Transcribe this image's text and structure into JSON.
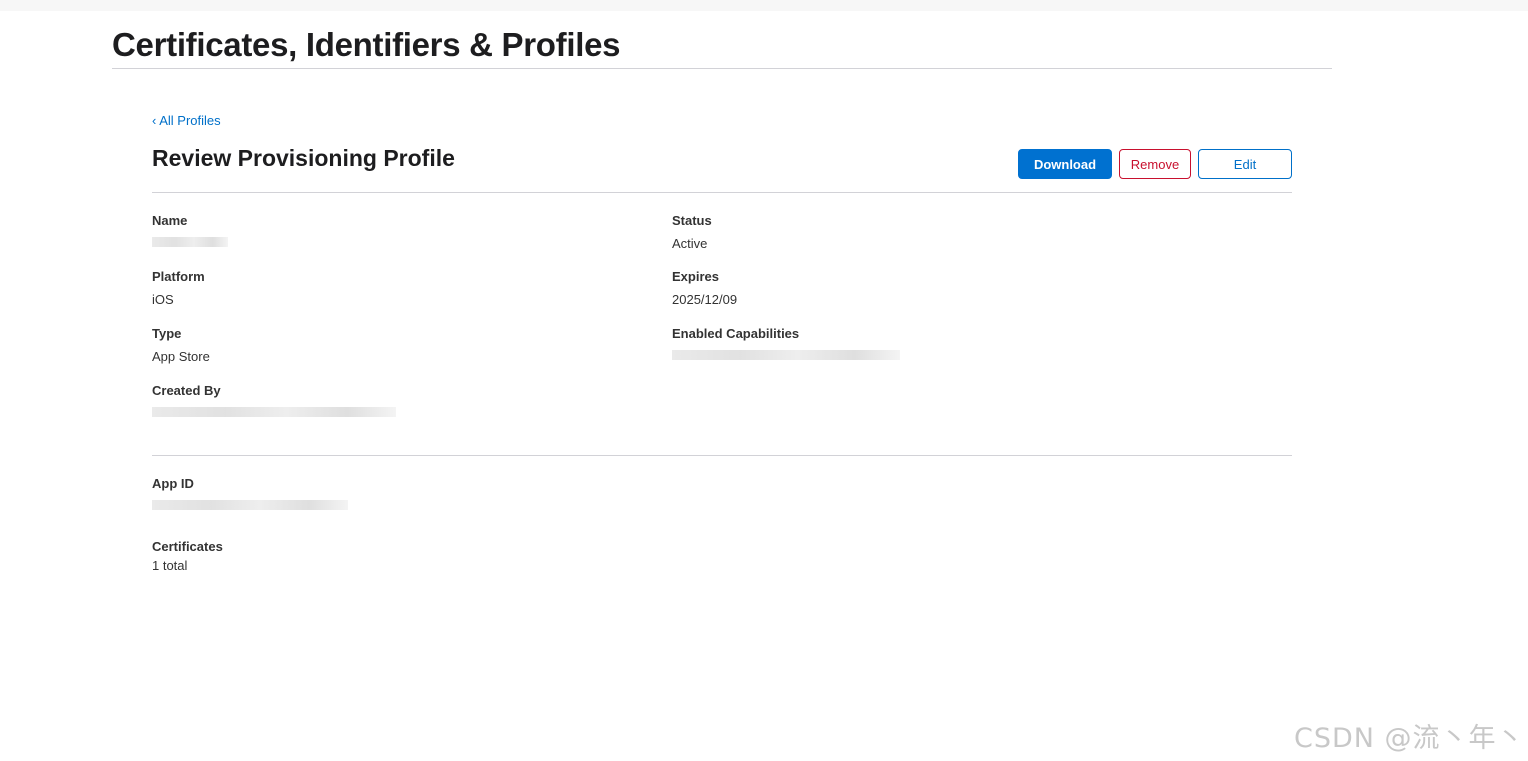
{
  "header": {
    "title": "Certificates, Identifiers & Profiles"
  },
  "nav": {
    "back_link": "‹ All Profiles"
  },
  "profile": {
    "section_title": "Review Provisioning Profile",
    "actions": {
      "download": "Download",
      "remove": "Remove",
      "edit": "Edit"
    },
    "fields": {
      "name": {
        "label": "Name"
      },
      "status": {
        "label": "Status",
        "value": "Active"
      },
      "platform": {
        "label": "Platform",
        "value": "iOS"
      },
      "expires": {
        "label": "Expires",
        "value": "2025/12/09"
      },
      "type": {
        "label": "Type",
        "value": "App Store"
      },
      "enabled_capabilities": {
        "label": "Enabled Capabilities"
      },
      "created_by": {
        "label": "Created By"
      },
      "app_id": {
        "label": "App ID"
      },
      "certificates": {
        "label": "Certificates",
        "value": "1 total"
      }
    }
  },
  "watermark": {
    "text": "CSDN @流丶年丶"
  },
  "colors": {
    "accent": "#0071d0",
    "danger": "#c8102e",
    "text": "#1d1d1f",
    "divider": "#d2d2d7"
  }
}
